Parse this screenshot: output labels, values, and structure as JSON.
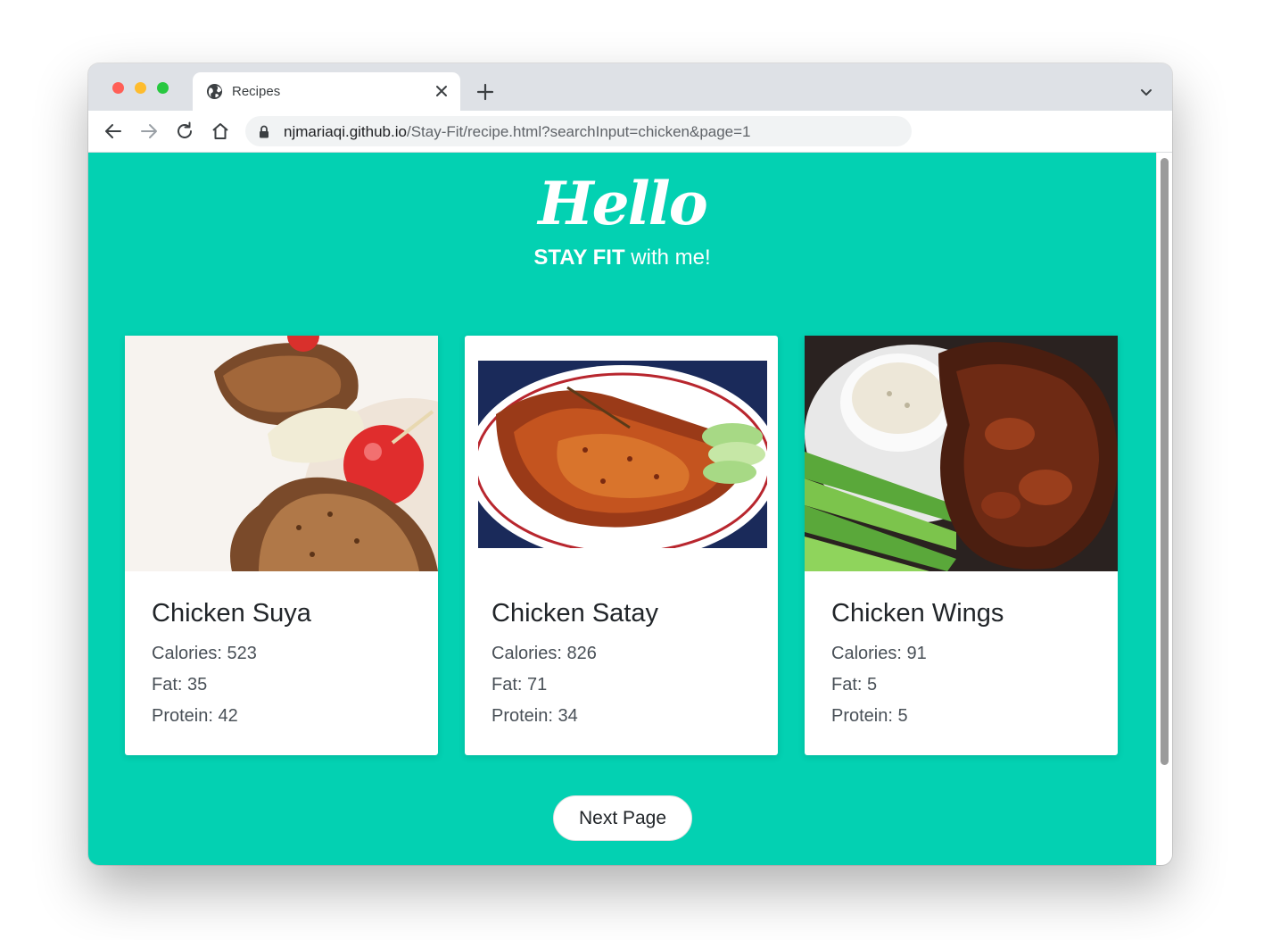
{
  "browser": {
    "tab_title": "Recipes",
    "url_host": "njmariaqi.github.io",
    "url_path": "/Stay-Fit/recipe.html?searchInput=chicken&page=1"
  },
  "hero": {
    "title": "Hello",
    "subtitle_strong": "STAY FIT",
    "subtitle_rest": " with me!"
  },
  "recipes": [
    {
      "name": "Chicken Suya",
      "calories": "Calories: 523",
      "fat": "Fat: 35",
      "protein": "Protein: 42"
    },
    {
      "name": "Chicken Satay",
      "calories": "Calories: 826",
      "fat": "Fat: 71",
      "protein": "Protein: 34"
    },
    {
      "name": "Chicken Wings",
      "calories": "Calories: 91",
      "fat": "Fat: 5",
      "protein": "Protein: 5"
    }
  ],
  "pagination": {
    "next_label": "Next Page"
  },
  "colors": {
    "page_background": "#03d1b2",
    "card_background": "#ffffff"
  }
}
